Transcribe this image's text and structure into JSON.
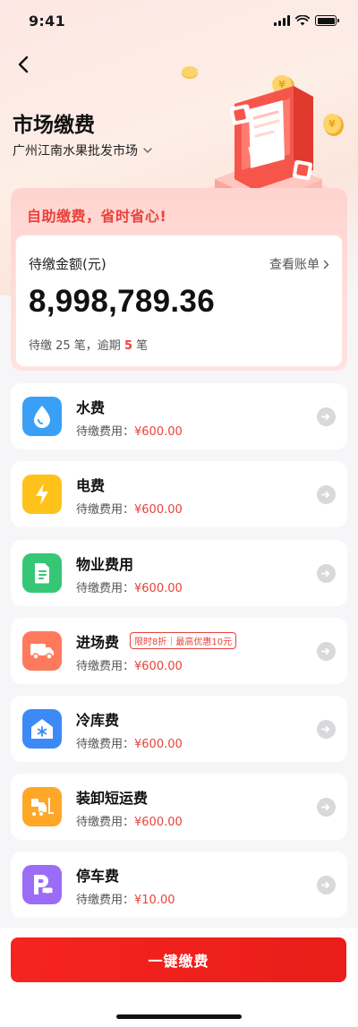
{
  "status_bar": {
    "time": "9:41"
  },
  "header": {
    "title": "市场缴费",
    "market": "广州江南水果批发市场"
  },
  "summary": {
    "slogan": "自助缴费，省时省心!",
    "due_label": "待缴金额(元)",
    "view_bill": "查看账单",
    "amount": "8,998,789.36",
    "count_prefix": "待缴 25 笔，逾期",
    "overdue_count": "5",
    "count_suffix": "笔"
  },
  "fees": [
    {
      "name": "水费",
      "amount_label": "待缴费用：",
      "amount": "¥600.00",
      "icon": "water-drop-icon",
      "color": "#3aa0f7"
    },
    {
      "name": "电费",
      "amount_label": "待缴费用：",
      "amount": "¥600.00",
      "icon": "lightning-icon",
      "color": "#ffc21a"
    },
    {
      "name": "物业费用",
      "amount_label": "待缴费用：",
      "amount": "¥600.00",
      "icon": "document-icon",
      "color": "#36c776"
    },
    {
      "name": "进场费",
      "amount_label": "待缴费用：",
      "amount": "¥600.00",
      "icon": "truck-icon",
      "color": "#ff7a5c",
      "tag": "限时8折｜最高优惠10元"
    },
    {
      "name": "冷库费",
      "amount_label": "待缴费用：",
      "amount": "¥600.00",
      "icon": "snowflake-house-icon",
      "color": "#3c8af5"
    },
    {
      "name": "装卸短运费",
      "amount_label": "待缴费用：",
      "amount": "¥600.00",
      "icon": "forklift-icon",
      "color": "#ffa726"
    },
    {
      "name": "停车费",
      "amount_label": "待缴费用：",
      "amount": "¥10.00",
      "icon": "parking-icon",
      "color": "#9b6cf7"
    }
  ],
  "actions": {
    "pay_all": "一键缴费"
  }
}
